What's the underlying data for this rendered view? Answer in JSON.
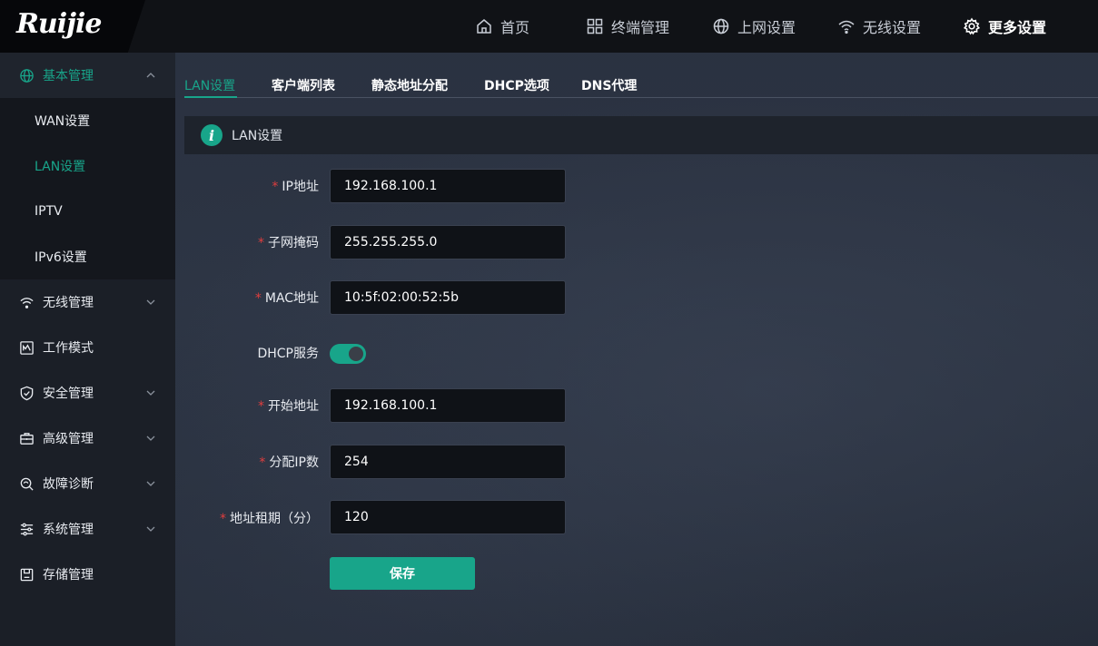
{
  "brand": {
    "logo_text": "Ruijie"
  },
  "topnav": [
    {
      "label": "首页",
      "icon": "home-icon"
    },
    {
      "label": "终端管理",
      "icon": "grid-icon"
    },
    {
      "label": "上网设置",
      "icon": "globe-icon"
    },
    {
      "label": "无线设置",
      "icon": "wifi-icon"
    },
    {
      "label": "更多设置",
      "icon": "gear-icon",
      "active": true
    }
  ],
  "sidebar": {
    "groups": [
      {
        "label": "基本管理",
        "icon": "globe-icon",
        "expanded": true
      },
      {
        "label": "无线管理",
        "icon": "wifi-icon"
      },
      {
        "label": "工作模式",
        "icon": "mode-icon"
      },
      {
        "label": "安全管理",
        "icon": "shield-icon"
      },
      {
        "label": "高级管理",
        "icon": "toolbox-icon"
      },
      {
        "label": "故障诊断",
        "icon": "diagnose-icon"
      },
      {
        "label": "系统管理",
        "icon": "settings-icon"
      },
      {
        "label": "存储管理",
        "icon": "storage-icon"
      }
    ],
    "subitems": [
      {
        "label": "WAN设置"
      },
      {
        "label": "LAN设置",
        "active": true
      },
      {
        "label": "IPTV"
      },
      {
        "label": "IPv6设置"
      }
    ]
  },
  "tabs": [
    {
      "label": "LAN设置",
      "active": true
    },
    {
      "label": "客户端列表"
    },
    {
      "label": "静态地址分配"
    },
    {
      "label": "DHCP选项"
    },
    {
      "label": "DNS代理"
    }
  ],
  "section": {
    "title": "LAN设置"
  },
  "form": {
    "ip_label": "IP地址",
    "ip_value": "192.168.100.1",
    "mask_label": "子网掩码",
    "mask_value": "255.255.255.0",
    "mac_label": "MAC地址",
    "mac_value": "10:5f:02:00:52:5b",
    "dhcp_label": "DHCP服务",
    "dhcp_enabled": true,
    "start_label": "开始地址",
    "start_value": "192.168.100.1",
    "count_label": "分配IP数",
    "count_value": "254",
    "lease_label": "地址租期（分）",
    "lease_value": "120",
    "required_mark": "*",
    "save_label": "保存"
  },
  "colors": {
    "accent": "#18a58a",
    "required": "#e03e3e"
  }
}
